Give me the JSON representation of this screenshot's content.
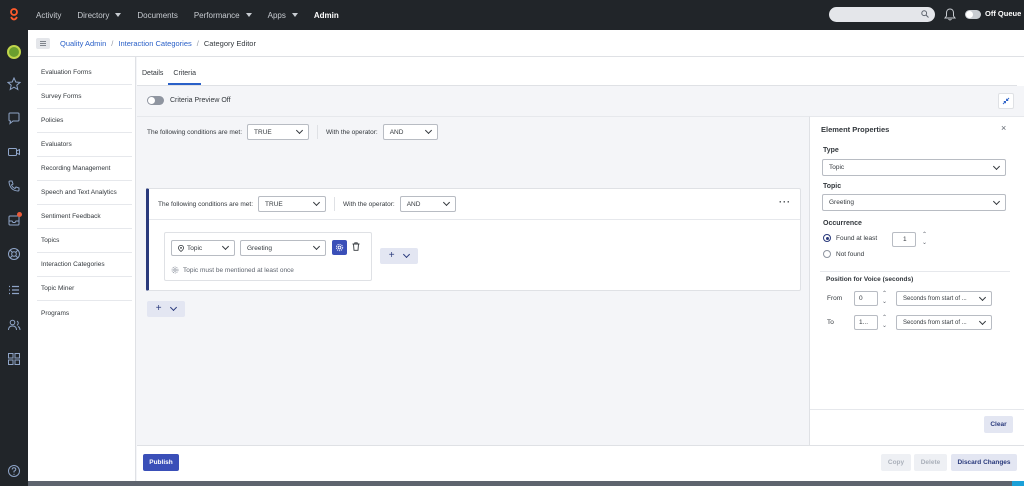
{
  "topnav": {
    "items": [
      "Activity",
      "Directory",
      "Documents",
      "Performance",
      "Apps",
      "Admin"
    ],
    "status": "Off Queue"
  },
  "breadcrumb": {
    "items": [
      "Quality Admin",
      "Interaction Categories"
    ],
    "current": "Category Editor"
  },
  "sidenav": {
    "items": [
      "Evaluation Forms",
      "Survey Forms",
      "Policies",
      "Evaluators",
      "Recording Management",
      "Speech and Text Analytics",
      "Sentiment Feedback",
      "Topics",
      "Interaction Categories",
      "Topic Miner",
      "Programs"
    ]
  },
  "tabs": [
    "Details",
    "Criteria"
  ],
  "editor": {
    "preview_label": "Criteria Preview Off",
    "outer": {
      "conditions_label": "The following conditions are met:",
      "conditions_value": "TRUE",
      "operator_label": "With the operator:",
      "operator_value": "AND"
    },
    "group": {
      "conditions_label": "The following conditions are met:",
      "conditions_value": "TRUE",
      "operator_label": "With the operator:",
      "operator_value": "AND",
      "menu": "···",
      "card": {
        "type_value": "Topic",
        "topic_value": "Greeting",
        "hint": "Topic must be mentioned at least once"
      }
    },
    "add_plus": "+"
  },
  "properties": {
    "title": "Element Properties",
    "close": "×",
    "type_label": "Type",
    "type_value": "Topic",
    "topic_label": "Topic",
    "topic_value": "Greeting",
    "occurrence_label": "Occurrence",
    "found_label": "Found at least",
    "found_value": "1",
    "not_found_label": "Not found",
    "position_label": "Position for Voice (seconds)",
    "from_label": "From",
    "from_value": "0",
    "from_unit": "Seconds from start of ...",
    "to_label": "To",
    "to_value": "1...",
    "to_unit": "Seconds from start of ...",
    "clear": "Clear"
  },
  "footer": {
    "publish": "Publish",
    "copy": "Copy",
    "delete": "Delete",
    "discard": "Discard Changes"
  },
  "colors": {
    "nav_bg": "#212529",
    "accent": "#3a4fb8",
    "link": "#2a60c8",
    "group_border": "#2a3a7c"
  }
}
